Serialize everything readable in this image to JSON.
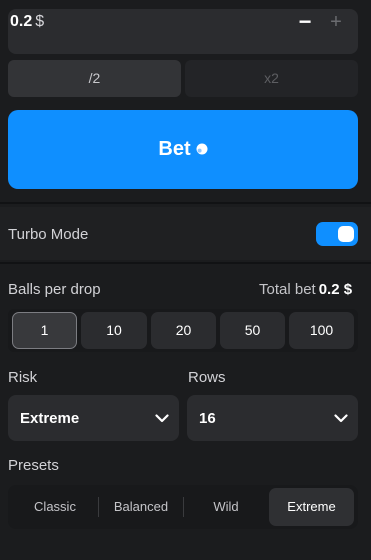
{
  "bet_amount": {
    "value": "0.2",
    "currency": "$",
    "minus_label": "−",
    "plus_label": "+"
  },
  "multipliers": {
    "half_label": "/2",
    "double_label": "x2"
  },
  "bet_button": {
    "label": "Bet",
    "icon": "ball-icon"
  },
  "turbo": {
    "label": "Turbo Mode",
    "enabled": true
  },
  "balls_per_drop": {
    "label": "Balls per drop",
    "total_prefix": "Total bet",
    "total_value": "0.2 $",
    "options": [
      "1",
      "10",
      "20",
      "50",
      "100"
    ],
    "selected": "1"
  },
  "risk": {
    "label": "Risk",
    "value": "Extreme"
  },
  "rows": {
    "label": "Rows",
    "value": "16"
  },
  "presets": {
    "label": "Presets",
    "options": [
      "Classic",
      "Balanced",
      "Wild",
      "Extreme"
    ],
    "selected": "Extreme"
  },
  "colors": {
    "accent": "#0f8fff",
    "background": "#1b1c1e",
    "control": "#2b2c2f"
  }
}
